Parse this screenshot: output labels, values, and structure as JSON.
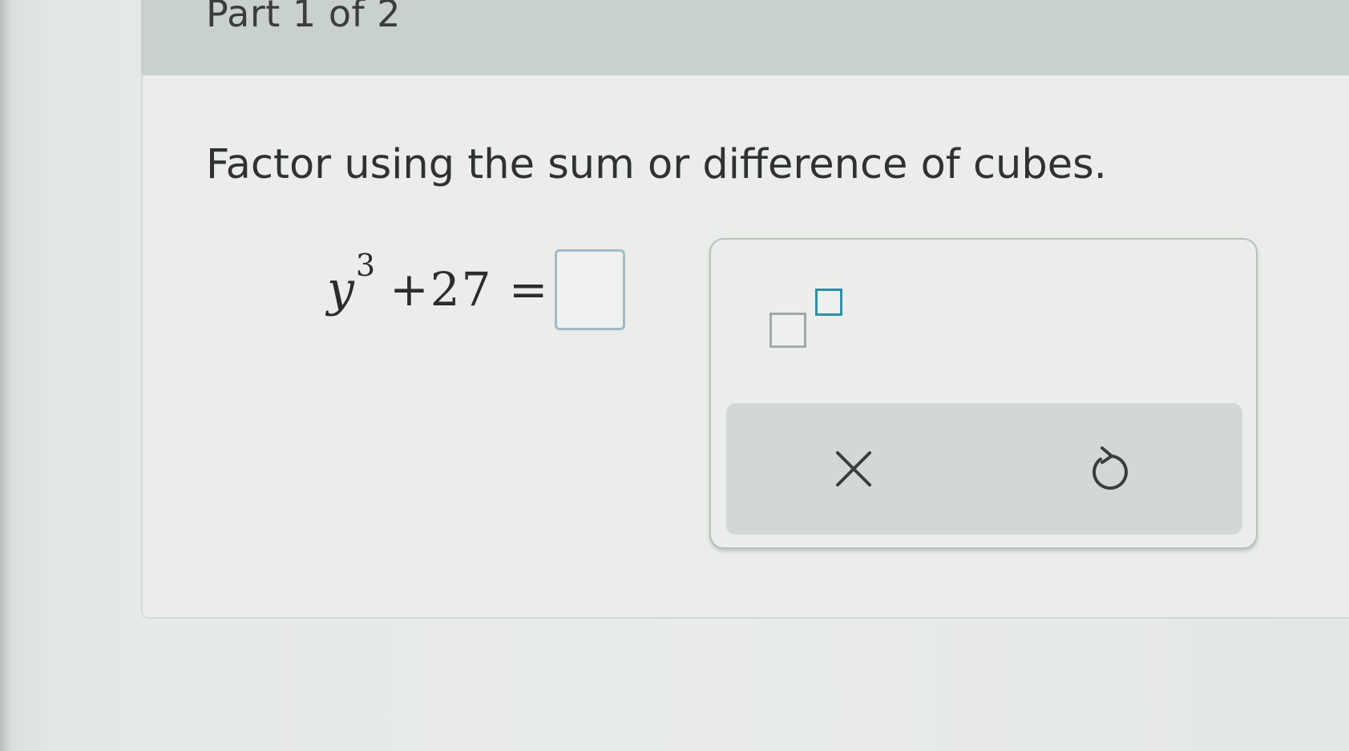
{
  "header": {
    "part_label": "Part 1 of 2"
  },
  "question": {
    "prompt": "Factor using the sum or difference of cubes.",
    "equation": {
      "variable": "y",
      "exponent": "3",
      "rest": "+27 ="
    },
    "answer_value": ""
  },
  "toolbar": {
    "tools": [
      {
        "icon": "exponent-template-icon"
      }
    ],
    "actions": [
      {
        "icon": "clear-x-icon"
      },
      {
        "icon": "undo-arrow-icon"
      }
    ]
  },
  "colors": {
    "accent": "#2f8fa8",
    "text": "#2f3231",
    "header_bg": "#c9d1cc",
    "action_bar_bg": "#d2d8d4"
  }
}
